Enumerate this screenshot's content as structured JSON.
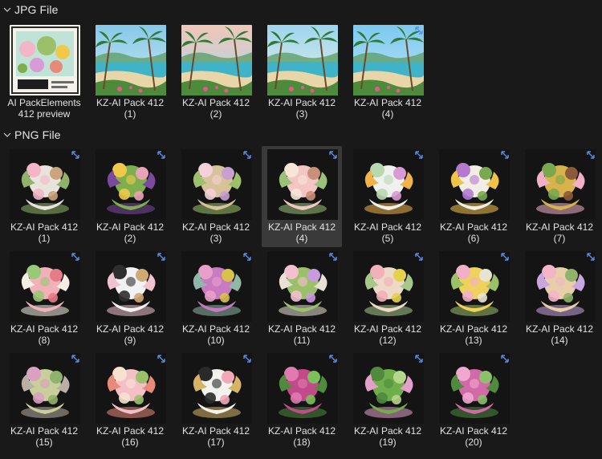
{
  "colors": {
    "background": "#191919",
    "selected": "#3a3a3a",
    "text": "#e2e2e2",
    "sync_arrow": "#5b8de8"
  },
  "groups": [
    {
      "title": "JPG File",
      "icon": "chevron-down-icon"
    },
    {
      "title": "PNG File",
      "icon": "chevron-down-icon"
    }
  ],
  "jpg_files": [
    {
      "line1": "AI PackElements",
      "line2": "412  preview",
      "thumb": "preview-collage"
    },
    {
      "line1": "KZ-AI Pack 412",
      "line2": "(1)",
      "thumb": "tropical-beach"
    },
    {
      "line1": "KZ-AI Pack 412",
      "line2": "(2)",
      "thumb": "tropical-beach"
    },
    {
      "line1": "KZ-AI Pack 412",
      "line2": "(3)",
      "thumb": "tropical-beach"
    },
    {
      "line1": "KZ-AI Pack 412",
      "line2": "(4)",
      "thumb": "tropical-beach"
    }
  ],
  "png_files": [
    {
      "line1": "KZ-AI Pack 412",
      "line2": "(1)",
      "thumb": "puppy"
    },
    {
      "line1": "KZ-AI Pack 412",
      "line2": "(2)",
      "thumb": "fruit-basket"
    },
    {
      "line1": "KZ-AI Pack 412",
      "line2": "(3)",
      "thumb": "basket"
    },
    {
      "line1": "KZ-AI Pack 412",
      "line2": "(4)",
      "thumb": "seashells",
      "selected": true
    },
    {
      "line1": "KZ-AI Pack 412",
      "line2": "(5)",
      "thumb": "duck-teacup"
    },
    {
      "line1": "KZ-AI Pack 412",
      "line2": "(6)",
      "thumb": "fruit-plate"
    },
    {
      "line1": "KZ-AI Pack 412",
      "line2": "(7)",
      "thumb": "pineapple"
    },
    {
      "line1": "KZ-AI Pack 412",
      "line2": "(8)",
      "thumb": "melon-plate"
    },
    {
      "line1": "KZ-AI Pack 412",
      "line2": "(9)",
      "thumb": "dalmatian"
    },
    {
      "line1": "KZ-AI Pack 412",
      "line2": "(10)",
      "thumb": "flower-jar"
    },
    {
      "line1": "KZ-AI Pack 412",
      "line2": "(11)",
      "thumb": "parrot"
    },
    {
      "line1": "KZ-AI Pack 412",
      "line2": "(12)",
      "thumb": "umbrella-ball"
    },
    {
      "line1": "KZ-AI Pack 412",
      "line2": "(13)",
      "thumb": "duck-float"
    },
    {
      "line1": "KZ-AI Pack 412",
      "line2": "(14)",
      "thumb": "kitten-float"
    },
    {
      "line1": "KZ-AI Pack 412",
      "line2": "(15)",
      "thumb": "mouse-hat"
    },
    {
      "line1": "KZ-AI Pack 412",
      "line2": "(16)",
      "thumb": "hat-drink"
    },
    {
      "line1": "KZ-AI Pack 412",
      "line2": "(17)",
      "thumb": "panda"
    },
    {
      "line1": "KZ-AI Pack 412",
      "line2": "(18)",
      "thumb": "sweet-pea"
    },
    {
      "line1": "KZ-AI Pack 412",
      "line2": "(19)",
      "thumb": "pea-pods"
    },
    {
      "line1": "KZ-AI Pack 412",
      "line2": "(20)",
      "thumb": "sweet-pea-flower"
    }
  ]
}
